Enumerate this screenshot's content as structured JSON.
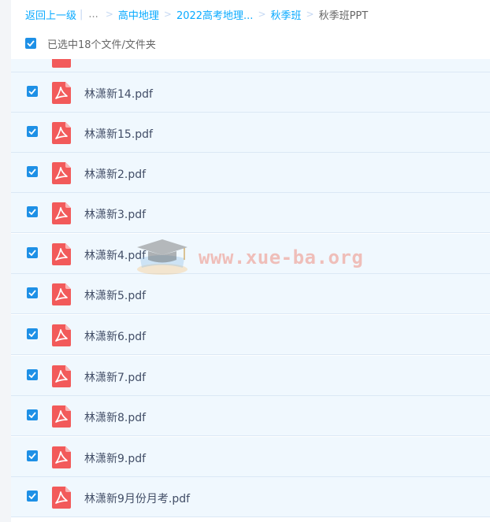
{
  "breadcrumb": {
    "back": "返回上一级",
    "sep": "|",
    "ellipsis": "...",
    "crumbs": [
      "高中地理",
      "2022高考地理...",
      "秋季班"
    ],
    "current": "秋季班PPT"
  },
  "selection": {
    "text": "已选中18个文件/文件夹",
    "checked": true
  },
  "files": [
    {
      "name": "林潇新14.pdf",
      "checked": true
    },
    {
      "name": "林潇新15.pdf",
      "checked": true
    },
    {
      "name": "林潇新2.pdf",
      "checked": true
    },
    {
      "name": "林潇新3.pdf",
      "checked": true
    },
    {
      "name": "林潇新4.pdf",
      "checked": true
    },
    {
      "name": "林潇新5.pdf",
      "checked": true
    },
    {
      "name": "林潇新6.pdf",
      "checked": true
    },
    {
      "name": "林潇新7.pdf",
      "checked": true
    },
    {
      "name": "林潇新8.pdf",
      "checked": true
    },
    {
      "name": "林潇新9.pdf",
      "checked": true
    },
    {
      "name": "林潇新9月份月考.pdf",
      "checked": true
    }
  ],
  "watermark": {
    "text": "www.xue-ba.org"
  },
  "colors": {
    "accent": "#09aaff",
    "checkbox": "#1e90e6",
    "pdf": "#f25a5a",
    "row_bg": "#f0f8fe"
  },
  "icons": {
    "file": "pdf-icon",
    "check": "checkmark-icon",
    "watermark": "graduation-cap-icon"
  }
}
